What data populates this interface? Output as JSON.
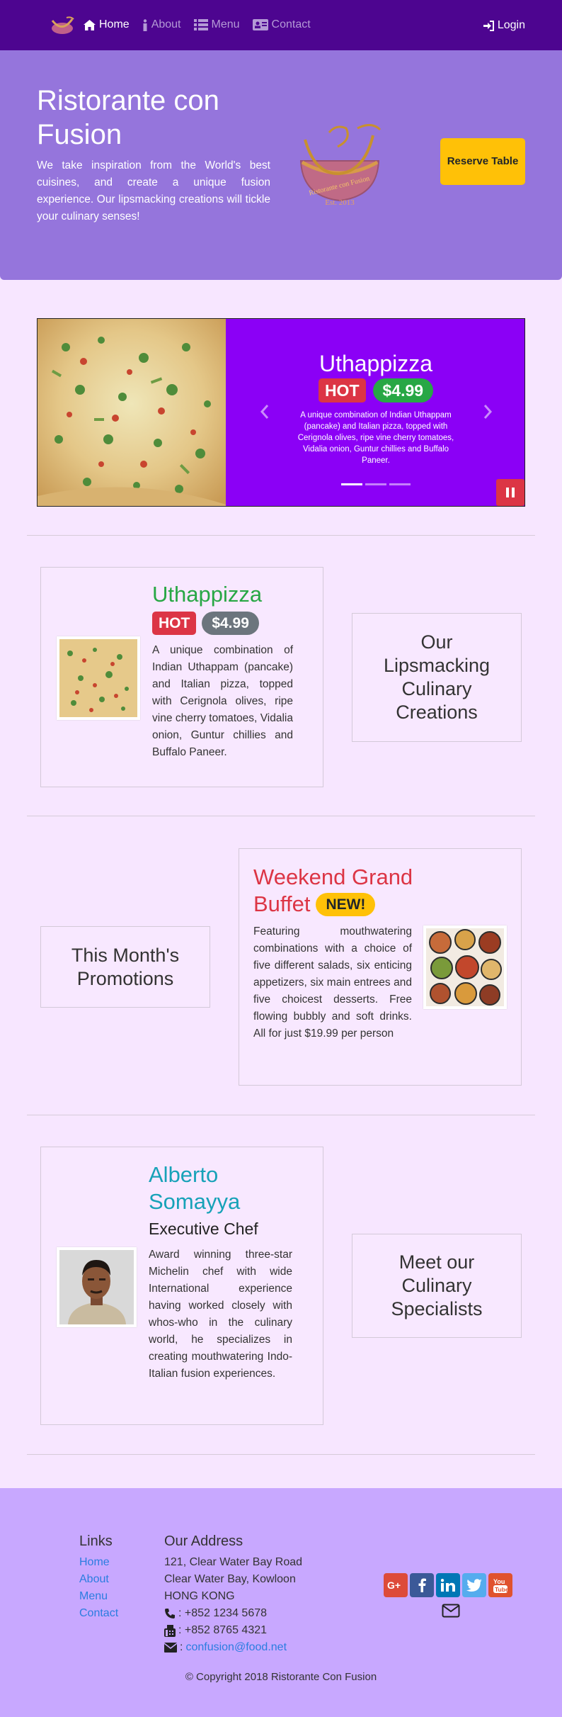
{
  "nav": {
    "items": [
      {
        "label": "Home"
      },
      {
        "label": "About"
      },
      {
        "label": "Menu"
      },
      {
        "label": "Contact"
      }
    ],
    "login": "Login"
  },
  "jumbotron": {
    "title": "Ristorante con Fusion",
    "text": "We take inspiration from the World's best cuisines, and create a unique fusion experience. Our lipsmacking creations will tickle your culinary senses!",
    "logo_text": "Ristorante con Fusion",
    "logo_est": "Est. 2013",
    "reserve_label": "Reserve Table"
  },
  "carousel": {
    "title": "Uthappizza",
    "hot": "HOT",
    "price": "$4.99",
    "text": "A unique combination of Indian Uthappam (pancake) and Italian pizza, topped with Cerignola olives, ripe vine cherry tomatoes, Vidalia onion, Guntur chillies and Buffalo Paneer.",
    "prev_icon": "chevron-left-icon",
    "next_icon": "chevron-right-icon",
    "pause_icon": "pause-icon"
  },
  "dish": {
    "title": "Uthappizza",
    "hot": "HOT",
    "price": "$4.99",
    "text": "A unique combination of Indian Uthappam (pancake) and Italian pizza, topped with Cerignola olives, ripe vine cherry tomatoes, Vidalia onion, Guntur chillies and Buffalo Paneer.",
    "side_label": "Our Lipsmacking Culinary Creations"
  },
  "promotion": {
    "title_line1": "Weekend Grand",
    "title_line2": "Buffet",
    "new": "NEW!",
    "text": "Featuring mouthwatering combinations with a choice of five different salads, six enticing appetizers, six main entrees and five choicest desserts. Free flowing bubbly and soft drinks. All for just $19.99 per person",
    "side_label": "This Month's Promotions"
  },
  "leader": {
    "name": "Alberto Somayya",
    "designation": "Executive Chef",
    "text": "Award winning three-star Michelin chef with wide International experience having worked closely with whos-who in the culinary world, he specializes in creating mouthwatering Indo-Italian fusion experiences.",
    "side_label": "Meet our Culinary Specialists"
  },
  "footer": {
    "links_title": "Links",
    "links": [
      "Home",
      "About",
      "Menu",
      "Contact"
    ],
    "address_title": "Our Address",
    "address": [
      "121, Clear Water Bay Road",
      "Clear Water Bay, Kowloon",
      "HONG KONG"
    ],
    "phone": ": +852 1234 5678",
    "fax": ": +852 8765 4321",
    "email_prefix": ":",
    "email": "confusion@food.net",
    "social": [
      "google-plus-icon",
      "facebook-icon",
      "linkedin-icon",
      "twitter-icon",
      "youtube-icon"
    ],
    "copyright": "© Copyright 2018 Ristorante Con Fusion"
  },
  "colors": {
    "navbar": "#4d0590",
    "jumbotron": "#9575dc",
    "carousel_bg": "#8b00f6",
    "page_bg": "#f7e6ff",
    "footer_bg": "#c8a8ff",
    "dish_title": "#28a745",
    "promo_title": "#dc3545",
    "leader_title": "#17a2b8"
  }
}
